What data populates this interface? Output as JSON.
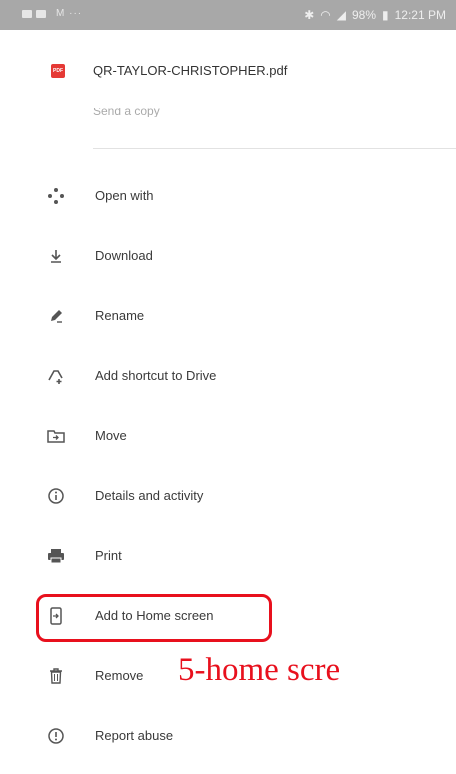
{
  "status_bar": {
    "time": "12:21 PM",
    "battery": "98%",
    "left_icons": [
      "image-icon",
      "gallery-icon",
      "email-icon"
    ],
    "right_icons": [
      "bluetooth-icon",
      "wifi-icon",
      "signal-icon",
      "battery-icon"
    ]
  },
  "file": {
    "name": "QR-TAYLOR-CHRISTOPHER.pdf",
    "icon": "pdf-icon",
    "icon_text": "PDF",
    "partial_item": "Send a copy"
  },
  "menu": {
    "items": [
      {
        "label": "Open with",
        "icon": "open-with-icon"
      },
      {
        "label": "Download",
        "icon": "download-icon"
      },
      {
        "label": "Rename",
        "icon": "rename-pencil-icon"
      },
      {
        "label": "Add shortcut to Drive",
        "icon": "add-shortcut-icon"
      },
      {
        "label": "Move",
        "icon": "move-folder-icon"
      },
      {
        "label": "Details and activity",
        "icon": "info-icon"
      },
      {
        "label": "Print",
        "icon": "print-icon"
      },
      {
        "label": "Add to Home screen",
        "icon": "add-to-home-icon"
      },
      {
        "label": "Remove",
        "icon": "trash-icon"
      },
      {
        "label": "Report abuse",
        "icon": "report-icon"
      }
    ]
  },
  "annotation": {
    "caption": "5-home scre",
    "color": "#e8101d"
  }
}
